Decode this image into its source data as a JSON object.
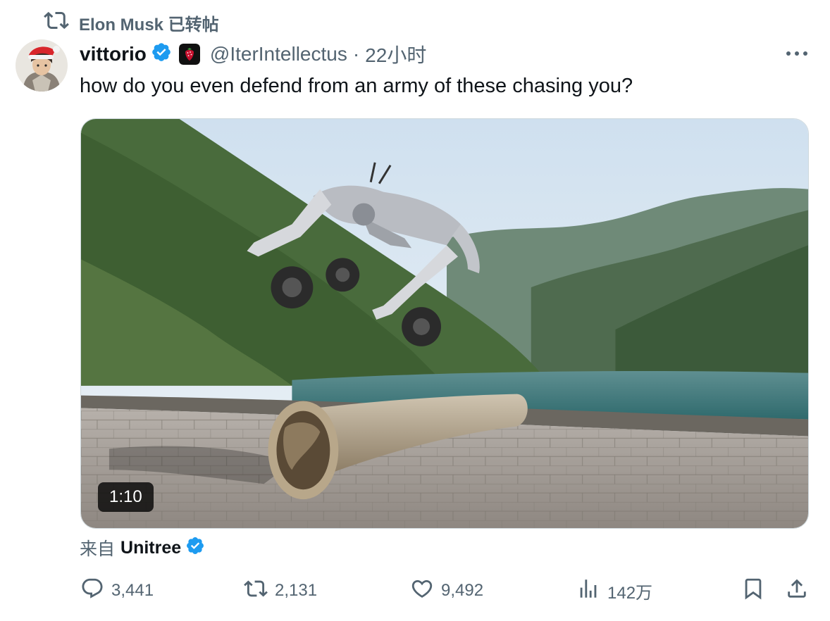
{
  "repost": {
    "text": "Elon Musk 已转帖",
    "icon": "repost-icon"
  },
  "author": {
    "name": "vittorio",
    "handle": "@IterIntellectus",
    "separator": "·",
    "time": "22小时",
    "verified_color": "#1d9bf0"
  },
  "tweet": {
    "text": "how do you even defend from an army of these chasing you?"
  },
  "media": {
    "type": "video",
    "duration": "1:10"
  },
  "source": {
    "prefix": "来自",
    "name": "Unitree"
  },
  "actions": {
    "replies": "3,441",
    "reposts": "2,131",
    "likes": "9,492",
    "views": "142万"
  }
}
